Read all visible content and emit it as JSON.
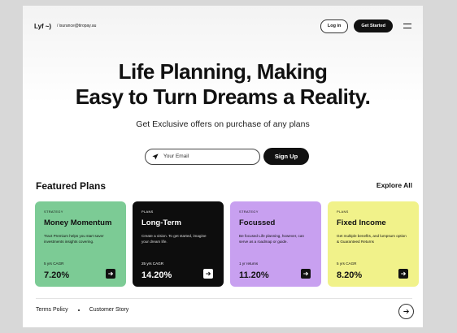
{
  "header": {
    "logo_text": "Lyf",
    "logo_mark": "~)",
    "email": "/ isurance@tiropay.au",
    "login_label": "Log in",
    "get_started_label": "Get Started"
  },
  "hero": {
    "headline_line1": "Life Planning, Making",
    "headline_line2": "Easy to Turn Dreams a Reality.",
    "subtitle": "Get Exclusive offers on purchase of any plans"
  },
  "signup_form": {
    "email_placeholder": "Your Email",
    "signup_label": "Sign Up"
  },
  "featured": {
    "title": "Featured Plans",
    "explore_label": "Explore All",
    "cards": [
      {
        "tag": "STRATEGY",
        "name": "Money Momentum",
        "desc": "Tract Premium helps you start saver investments insights covering.",
        "cagr": "5 yrs CAGR",
        "value": "7.20%",
        "color": "#7ccb95"
      },
      {
        "tag": "PLANS",
        "name": "Long-Term",
        "desc": "Create a vision. To get started, imagine your dream life.",
        "cagr": "25 yrs CAGR",
        "value": "14.20%",
        "color": "#0d0d0d"
      },
      {
        "tag": "STRATEGY",
        "name": "Focussed",
        "desc": "Be focused Life planning, however, can serve as a roadmap or guide.",
        "cagr": "1 yr returns",
        "value": "11.20%",
        "color": "#c8a0f0"
      },
      {
        "tag": "PLANS",
        "name": "Fixed Income",
        "desc": "Get multiple benefits, and lumpsum option & Guaranteed Returns",
        "cagr": "5 yrs CAGR",
        "value": "8.20%",
        "color": "#f1f28a"
      }
    ]
  },
  "footer": {
    "links": [
      "Terms Policy",
      "Customer Story"
    ]
  },
  "icons": {
    "send": "paper-plane-icon",
    "card_arrow": "arrow-right-icon",
    "menu": "hamburger-menu-icon",
    "footer_arrow": "circle-arrow-right-icon"
  }
}
